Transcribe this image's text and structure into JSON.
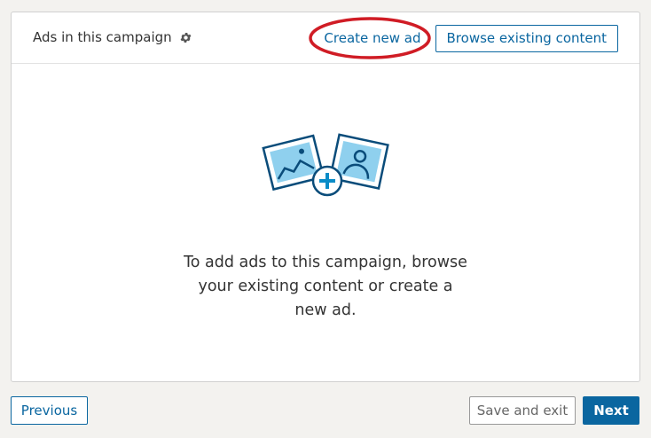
{
  "card": {
    "title": "Ads in this campaign",
    "settings_icon": "gear-icon",
    "create_new_ad_label": "Create new ad",
    "browse_existing_label": "Browse existing content"
  },
  "empty_state": {
    "illustration_icon": "add-image-icon",
    "message": "To add ads to this campaign, browse your existing content or create a new ad."
  },
  "footer": {
    "previous_label": "Previous",
    "save_exit_label": "Save and exit",
    "next_label": "Next"
  },
  "colors": {
    "accent": "#0a66a0",
    "highlight": "#d01c25",
    "background": "#f3f2ef"
  }
}
